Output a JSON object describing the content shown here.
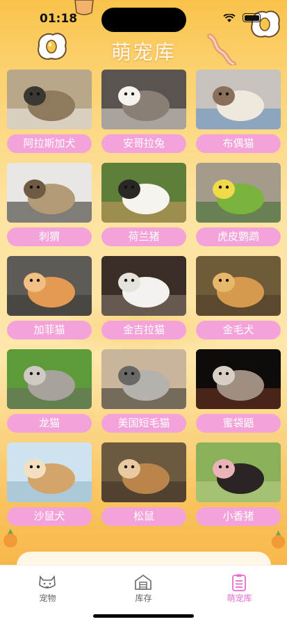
{
  "status_bar": {
    "time": "01:18"
  },
  "header": {
    "title": "萌宠库"
  },
  "pets": [
    {
      "name": "阿拉斯加犬",
      "icon": "alaskan-dog"
    },
    {
      "name": "安哥拉兔",
      "icon": "angora-rabbit"
    },
    {
      "name": "布偶猫",
      "icon": "ragdoll-cat"
    },
    {
      "name": "刺猬",
      "icon": "hedgehog"
    },
    {
      "name": "荷兰猪",
      "icon": "guinea-pig"
    },
    {
      "name": "虎皮鹦鹉",
      "icon": "budgerigar"
    },
    {
      "name": "加菲猫",
      "icon": "exotic-cat"
    },
    {
      "name": "金吉拉猫",
      "icon": "chinchilla-cat"
    },
    {
      "name": "金毛犬",
      "icon": "golden-retriever"
    },
    {
      "name": "龙猫",
      "icon": "chinchilla"
    },
    {
      "name": "美国短毛猫",
      "icon": "american-shorthair"
    },
    {
      "name": "蜜袋鼯",
      "icon": "sugar-glider"
    },
    {
      "name": "沙鼠犬",
      "icon": "gerbil"
    },
    {
      "name": "松鼠",
      "icon": "chipmunk"
    },
    {
      "name": "小香猪",
      "icon": "mini-pig"
    }
  ],
  "tab_bar": {
    "tabs": [
      {
        "label": "宠物",
        "icon": "cat-face-icon",
        "active": false
      },
      {
        "label": "库存",
        "icon": "warehouse-icon",
        "active": false
      },
      {
        "label": "萌宠库",
        "icon": "list-icon",
        "active": true
      }
    ],
    "active_color": "#e76bd0"
  },
  "colors": {
    "pill": "#f3a3da",
    "background": "#fde7a1"
  }
}
